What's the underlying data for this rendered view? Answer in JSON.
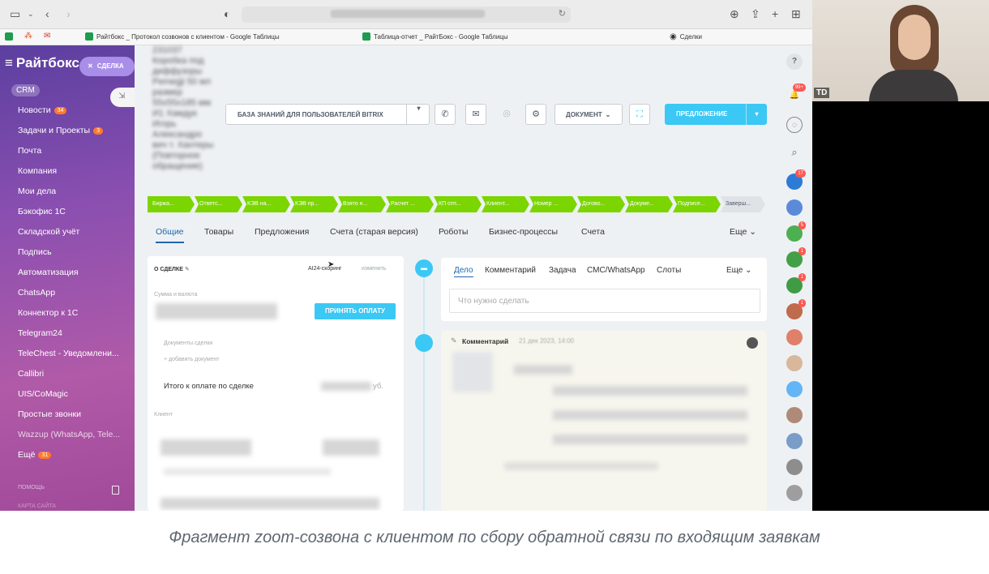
{
  "bookmarks": [
    "Райтбокс _ Протокол созвонов с клиентом - Google Таблицы",
    "Таблица-отчет _ РайтБокс - Google Таблицы",
    "Сделки"
  ],
  "nav": {
    "logo": "Райтбокс",
    "deal_chip": "СДЕЛКА",
    "crm": "CRM",
    "items": [
      {
        "label": "Новости",
        "count": "34"
      },
      {
        "label": "Задачи и Проекты",
        "count": "3"
      },
      {
        "label": "Почта",
        "count": ""
      },
      {
        "label": "Компания",
        "count": ""
      },
      {
        "label": "Мои дела",
        "count": ""
      },
      {
        "label": "Бэкофис 1С",
        "count": ""
      },
      {
        "label": "Складской учёт",
        "count": ""
      },
      {
        "label": "Подпись",
        "count": ""
      },
      {
        "label": "Автоматизация",
        "count": ""
      },
      {
        "label": "ChatsApp",
        "count": ""
      },
      {
        "label": "Коннектор к 1С",
        "count": ""
      },
      {
        "label": "Telegram24",
        "count": ""
      },
      {
        "label": "TeleChest - Уведомлени...",
        "count": ""
      },
      {
        "label": "Callibri",
        "count": ""
      },
      {
        "label": "UIS/CoMagic",
        "count": ""
      },
      {
        "label": "Простые звонки",
        "count": ""
      },
      {
        "label": "Wazzup (WhatsApp, Tele...",
        "count": ""
      },
      {
        "label": "Ещё",
        "count": "31"
      }
    ],
    "help": "ПОМОЩЬ",
    "sitemap": "КАРТА САЙТА"
  },
  "header": {
    "deal_title_blurred": "231037 Коробка под диффузоры Pemegji 50 мл размер 55х55х185 мм И1 Хамдук Игорь Александро вич т. Хантеры (Повторное обращение)",
    "kb_button": "БАЗА ЗНАНИЙ ДЛЯ ПОЛЬЗОВАТЕЛЕЙ BITRIX",
    "doc_button": "ДОКУМЕНТ",
    "offer_button": "ПРЕДЛОЖЕНИЕ"
  },
  "stages": [
    "Биржа...",
    "Ответс...",
    "КЭВ на...",
    "КЭВ пр...",
    "Взято н...",
    "Расчет ...",
    "КП отп...",
    "Клиент...",
    "Номер ...",
    "Догово...",
    "Докуме...",
    "Подписе...",
    "Заверш..."
  ],
  "tabs": [
    "Общие",
    "Товары",
    "Предложения",
    "Счета (старая версия)",
    "Роботы",
    "Бизнес-процессы",
    "Счета",
    "Еще"
  ],
  "card": {
    "heading": "О СДЕЛКЕ",
    "ai_label": "AI24-скоринг",
    "change_label": "изменить",
    "sum_label": "Сумма и валюта",
    "pay_button": "ПРИНЯТЬ ОПЛАТУ",
    "docs_label": "Документы сделки",
    "add_doc": "+ добавить документ",
    "total_label": "Итого к оплате по сделке",
    "total_suffix": "уб.",
    "client_label": "Клиент"
  },
  "activity": {
    "tabs": [
      "Дело",
      "Комментарий",
      "Задача",
      "СМС/WhatsApp",
      "Слоты",
      "Еще"
    ],
    "placeholder": "Что нужно сделать",
    "comment_title": "Комментарий",
    "comment_date": "21 дек 2023, 14:00"
  },
  "rightrail": {
    "badges": [
      "99+",
      "17",
      "5",
      "1",
      "1",
      "1",
      "1"
    ]
  },
  "webcam": {
    "name": "TD"
  },
  "caption": "Фрагмент zoom-созвона с клиентом по сбору обратной связи по входящим заявкам",
  "colors": {
    "accent": "#3bc8f5",
    "stage": "#7bd500",
    "link": "#2067b0"
  }
}
